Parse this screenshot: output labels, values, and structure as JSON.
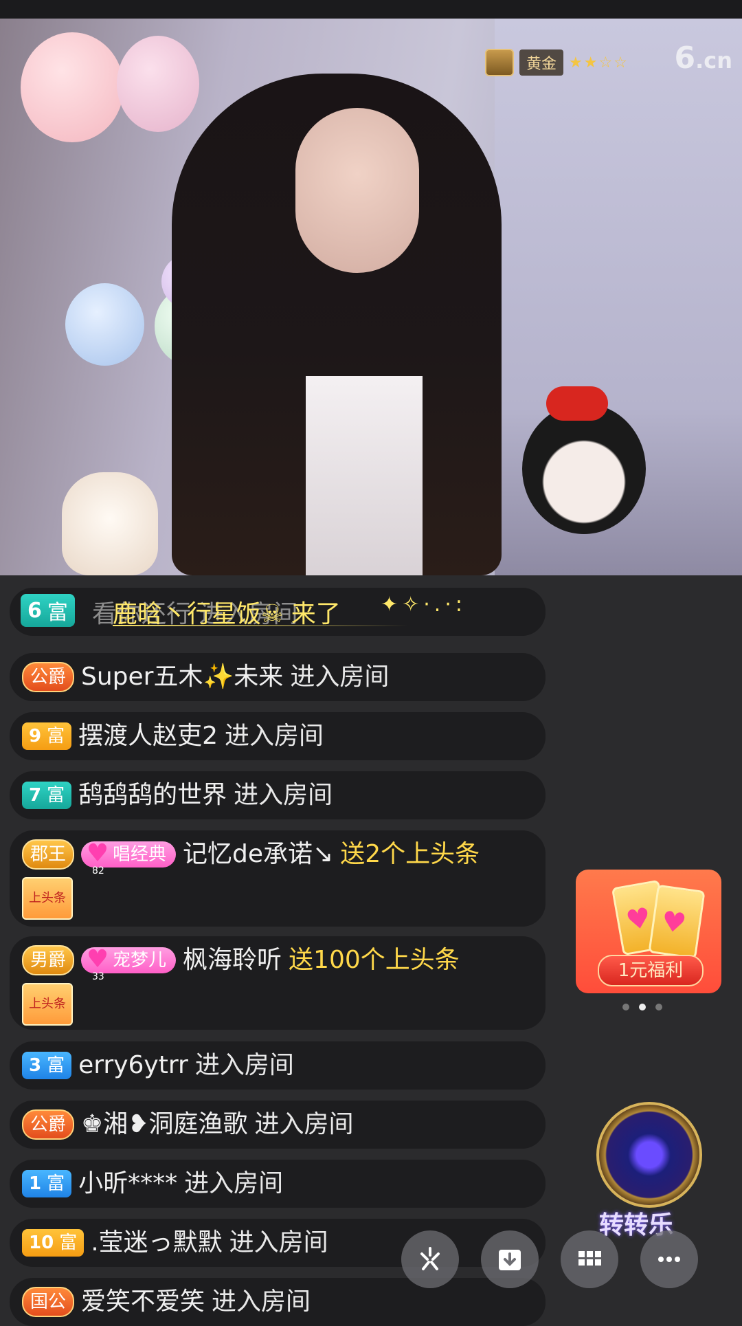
{
  "stream": {
    "rank_label": "黄金",
    "stars": "★★☆☆",
    "logo_main": "6",
    "logo_sub": ".cn"
  },
  "entry_banner": {
    "badge_num": "6",
    "badge_label": "富",
    "ghost_text": "看你还行 进入房间",
    "text": "鹿晗丶行星饭☠ 来了",
    "sparkle": "✦✧·.·:"
  },
  "messages": [
    {
      "badge": "公爵",
      "name": "Super五木✨未来",
      "action": "进入房间"
    },
    {
      "badge_num": "9",
      "badge_label": "富",
      "name": "摆渡人赵吏2",
      "action": "进入房间"
    },
    {
      "badge_num": "7",
      "badge_label": "富",
      "name": "鸹鸹鸹的世界",
      "action": "进入房间"
    },
    {
      "badge": "郡王",
      "fan_level": "82",
      "fan_label": "唱经典",
      "name": "记忆de承诺↘",
      "gift": "送2个上头条",
      "sticker": "上头条"
    },
    {
      "badge": "男爵",
      "fan_level": "33",
      "fan_label": "宠梦儿",
      "name": "枫海聆听",
      "gift": "送100个上头条",
      "sticker": "上头条"
    },
    {
      "badge_num": "3",
      "badge_label": "富",
      "name": "erry6ytrr",
      "action": "进入房间"
    },
    {
      "badge": "公爵",
      "name": "♚湘❥洞庭渔歌",
      "action": "进入房间"
    },
    {
      "badge_num": "1",
      "badge_label": "富",
      "name": "小昕****",
      "action": "进入房间"
    },
    {
      "badge_num": "10",
      "badge_label": "富",
      "name": ".莹迷っ默默",
      "action": "进入房间"
    },
    {
      "badge": "国公",
      "name": "爱笑不爱笑",
      "action": "进入房间"
    }
  ],
  "promo": {
    "label": "1元福利"
  },
  "wheel": {
    "label": "转转乐"
  },
  "toolbar": {
    "icons": [
      "six-logo-icon",
      "download-icon",
      "grid-icon",
      "more-icon"
    ]
  },
  "colors": {
    "chat_bg": "#1d1d1f",
    "page_bg": "#2b2b2d",
    "gift_text": "#ffd84a",
    "banner_text": "#ffe86a"
  }
}
